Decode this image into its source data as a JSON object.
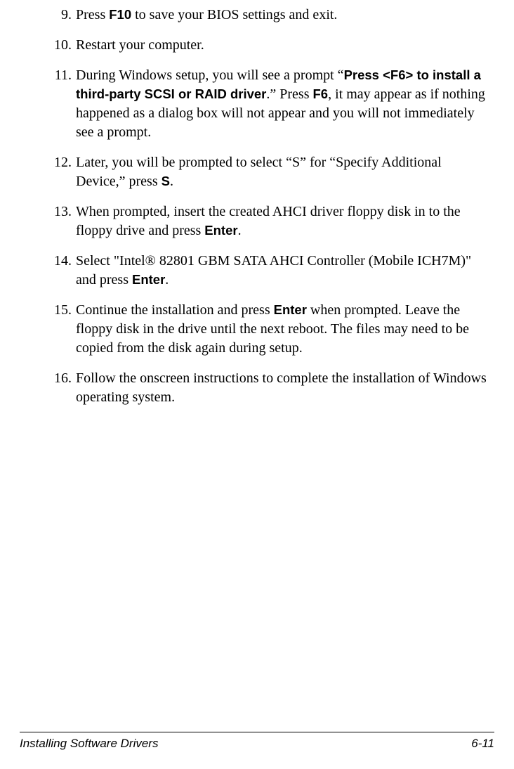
{
  "steps": {
    "s9": {
      "num": "9.",
      "t1": "Press ",
      "b1": "F10",
      "t2": " to save your BIOS settings and exit."
    },
    "s10": {
      "num": "10.",
      "t1": "Restart your computer."
    },
    "s11": {
      "num": "11.",
      "t1": "During Windows setup, you will see a prompt “",
      "b1": "Press <F6> to install a third-party SCSI or RAID driver",
      "t2": ".” Press ",
      "b2": "F6",
      "t3": ", it may appear as if nothing happened as a dialog box will not appear and you will not immediately see a prompt."
    },
    "s12": {
      "num": "12.",
      "t1": "Later, you will be prompted to select “S” for “Specify Additional Device,” press ",
      "b1": "S",
      "t2": "."
    },
    "s13": {
      "num": "13.",
      "t1": "When prompted, insert the created AHCI driver floppy disk in to the floppy drive and press ",
      "b1": "Enter",
      "t2": "."
    },
    "s14": {
      "num": "14.",
      "t1": "Select \"Intel® 82801 GBM SATA AHCI Controller (Mobile ICH7M)\" and press ",
      "b1": "Enter",
      "t2": "."
    },
    "s15": {
      "num": "15.",
      "t1": "Continue the installation and press ",
      "b1": "Enter",
      "t2": " when prompted. Leave the floppy disk in the drive until the next reboot. The files may need to be copied from the disk again during setup."
    },
    "s16": {
      "num": "16.",
      "t1": "Follow the onscreen instructions to complete the installation of Windows operating system."
    }
  },
  "footer": {
    "title": "Installing Software Drivers",
    "page": "6-11"
  }
}
